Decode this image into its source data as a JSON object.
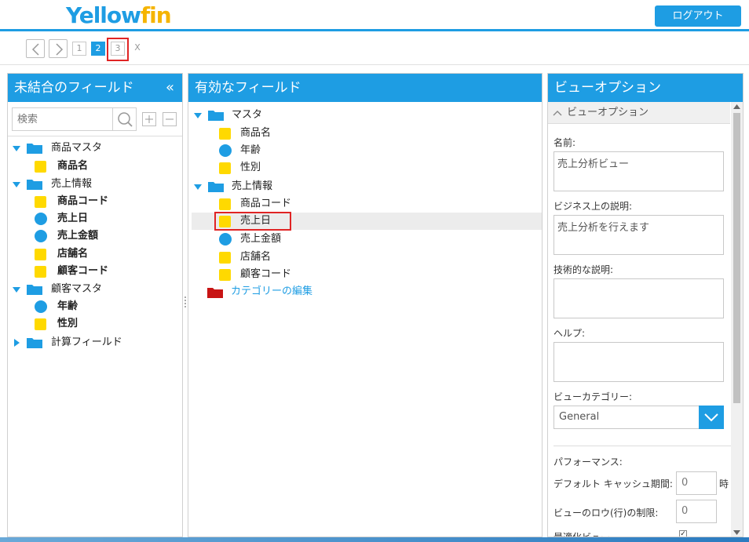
{
  "header": {
    "logo_main": "Yellow",
    "logo_accent": "fin",
    "logout_label": "ログアウト"
  },
  "steps": {
    "prev_icon": "chevron-left-icon",
    "next_icon": "chevron-right-icon",
    "items": [
      "1",
      "2",
      "3",
      "X"
    ],
    "active": "2"
  },
  "left_panel": {
    "title": "未結合のフィールド",
    "search_placeholder": "検索",
    "groups": [
      {
        "name": "商品マスタ",
        "fields": [
          {
            "label": "商品名",
            "type": "dimension"
          }
        ]
      },
      {
        "name": "売上情報",
        "fields": [
          {
            "label": "商品コード",
            "type": "dimension"
          },
          {
            "label": "売上日",
            "type": "metric"
          },
          {
            "label": "売上金額",
            "type": "metric"
          },
          {
            "label": "店舗名",
            "type": "dimension"
          },
          {
            "label": "顧客コード",
            "type": "dimension"
          }
        ]
      },
      {
        "name": "顧客マスタ",
        "fields": [
          {
            "label": "年齢",
            "type": "metric"
          },
          {
            "label": "性別",
            "type": "dimension"
          }
        ]
      },
      {
        "name": "計算フィールド",
        "fields": []
      }
    ]
  },
  "middle_panel": {
    "title": "有効なフィールド",
    "groups": [
      {
        "name": "マスタ",
        "fields": [
          {
            "label": "商品名",
            "type": "dimension"
          },
          {
            "label": "年齢",
            "type": "metric"
          },
          {
            "label": "性別",
            "type": "dimension"
          }
        ]
      },
      {
        "name": "売上情報",
        "fields": [
          {
            "label": "商品コード",
            "type": "dimension"
          },
          {
            "label": "売上日",
            "type": "dimension"
          },
          {
            "label": "売上金額",
            "type": "metric"
          },
          {
            "label": "店舗名",
            "type": "dimension"
          },
          {
            "label": "顧客コード",
            "type": "dimension"
          }
        ]
      }
    ],
    "edit_category_label": "カテゴリーの編集"
  },
  "right_panel": {
    "title": "ビューオプション",
    "section_title": "ビューオプション",
    "name_label": "名前:",
    "name_value": "売上分析ビュー",
    "biz_desc_label": "ビジネス上の説明:",
    "biz_desc_value": "売上分析を行えます",
    "tech_desc_label": "技術的な説明:",
    "tech_desc_value": "",
    "help_label": "ヘルプ:",
    "help_value": "",
    "category_label": "ビューカテゴリー:",
    "category_value": "General",
    "performance_label": "パフォーマンス:",
    "cache_label": "デフォルト キャッシュ期間:",
    "cache_value": "0",
    "cache_unit": "時",
    "row_limit_label": "ビューのロウ(行)の制限:",
    "row_limit_value": "0",
    "optimized_label": "最適化ビュー"
  },
  "colors": {
    "accent": "#1e9de3",
    "highlight": "#e02424",
    "dimension": "#ffd900",
    "logo_accent": "#f5b400"
  }
}
